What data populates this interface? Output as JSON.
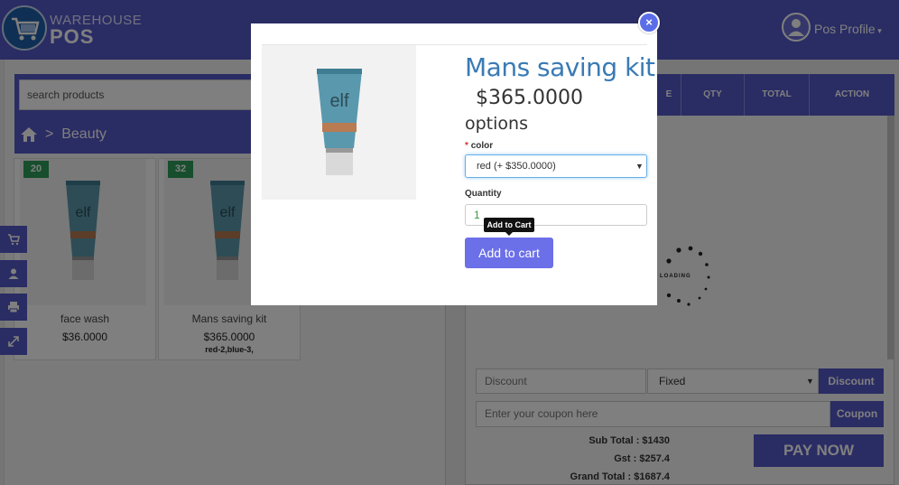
{
  "header": {
    "logo_line1": "WAREHOUSE",
    "logo_line2": "POS",
    "profile_label": "Pos Profile"
  },
  "search": {
    "placeholder": "search products"
  },
  "breadcrumb": {
    "separator": ">",
    "category": "Beauty"
  },
  "products": [
    {
      "stock": "20",
      "name": "face wash",
      "price": "$36.0000",
      "variants": ""
    },
    {
      "stock": "32",
      "name": "Mans saving kit",
      "price": "$365.0000",
      "variants": "red-2,blue-3,"
    }
  ],
  "cart_table": {
    "headers": [
      "E",
      "QTY",
      "TOTAL",
      "ACTION"
    ]
  },
  "loader_text": "LOADING",
  "discount": {
    "input_placeholder": "Discount",
    "type_value": "Fixed",
    "button_label": "Discount"
  },
  "coupon": {
    "input_placeholder": "Enter your coupon here",
    "button_label": "Coupon"
  },
  "summary": {
    "sub_total": "Sub Total : $1430",
    "gst": "Gst : $257.4",
    "grand_total": "Grand Total : $1687.4"
  },
  "pay_button": "PAY NOW",
  "modal": {
    "close_glyph": "×",
    "title": "Mans saving kit",
    "price": "$365.0000",
    "options_heading": "options",
    "color_required_mark": "*",
    "color_label": "color",
    "color_selected": "red (+ $350.0000)",
    "quantity_label": "Quantity",
    "quantity_value": "1",
    "tooltip": "Add to Cart",
    "add_button": "Add to cart"
  },
  "colors": {
    "brand": "#5558c8",
    "badge": "#2e9c5a",
    "title_blue": "#3a7ab4",
    "button": "#6b6fe8"
  },
  "icons": [
    "cart-logo-icon",
    "user-icon",
    "caret-down-icon",
    "home-icon",
    "cart-icon",
    "profile-icon",
    "print-icon",
    "expand-icon",
    "close-icon",
    "loading-spinner-icon"
  ]
}
